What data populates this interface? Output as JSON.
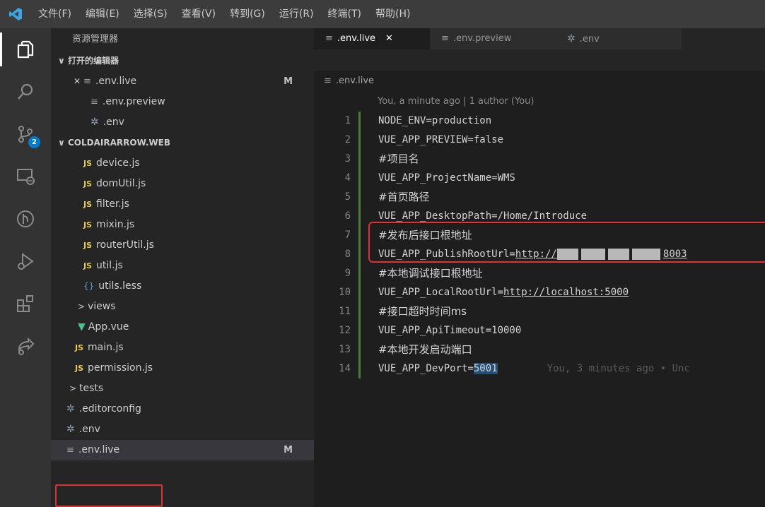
{
  "menu": [
    "文件(F)",
    "编辑(E)",
    "选择(S)",
    "查看(V)",
    "转到(G)",
    "运行(R)",
    "终端(T)",
    "帮助(H)"
  ],
  "activity": {
    "scm_badge": "2"
  },
  "sidebar": {
    "title": "资源管理器",
    "open_editors_label": "打开的编辑器",
    "open_editors": [
      {
        "name": ".env.live",
        "status": "M"
      },
      {
        "name": ".env.preview"
      },
      {
        "name": ".env"
      }
    ],
    "project_label": "COLDAIRARROW.WEB",
    "files": [
      {
        "name": "device.js",
        "kind": "js",
        "js_tag": "JS"
      },
      {
        "name": "domUtil.js",
        "kind": "js",
        "js_tag": "JS"
      },
      {
        "name": "filter.js",
        "kind": "js",
        "js_tag": "JS"
      },
      {
        "name": "mixin.js",
        "kind": "js",
        "js_tag": "JS"
      },
      {
        "name": "routerUtil.js",
        "kind": "js",
        "js_tag": "JS"
      },
      {
        "name": "util.js",
        "kind": "js",
        "js_tag": "JS"
      },
      {
        "name": "utils.less",
        "kind": "less"
      },
      {
        "name": "views",
        "kind": "folder"
      },
      {
        "name": "App.vue",
        "kind": "vue"
      },
      {
        "name": "main.js",
        "kind": "js",
        "js_tag": "JS"
      },
      {
        "name": "permission.js",
        "kind": "js",
        "js_tag": "JS"
      },
      {
        "name": "tests",
        "kind": "folder"
      },
      {
        "name": ".editorconfig",
        "kind": "gear"
      },
      {
        "name": ".env",
        "kind": "gear"
      },
      {
        "name": ".env.live",
        "kind": "lines",
        "status": "M"
      }
    ]
  },
  "tabs": [
    {
      "label": ".env.live",
      "active": true
    },
    {
      "label": ".env.preview",
      "active": false
    },
    {
      "label": ".env",
      "active": false
    }
  ],
  "breadcrumb": ".env.live",
  "editor": {
    "blame_header": "You, a minute ago | 1 author (You)",
    "lines": [
      {
        "n": "1",
        "text": "NODE_ENV=production"
      },
      {
        "n": "2",
        "text": "VUE_APP_PREVIEW=false"
      },
      {
        "n": "3",
        "text": "#项目名"
      },
      {
        "n": "4",
        "text": "VUE_APP_ProjectName=WMS"
      },
      {
        "n": "5",
        "text": "#首页路径"
      },
      {
        "n": "6",
        "text": "VUE_APP_DesktopPath=/Home/Introduce"
      },
      {
        "n": "7",
        "text": "#发布后接口根地址"
      },
      {
        "n": "8",
        "key": "VUE_APP_PublishRootUrl=",
        "url_prefix": "http://",
        "url_suffix": "8003"
      },
      {
        "n": "9",
        "text": "#本地调试接口根地址"
      },
      {
        "n": "10",
        "key": "VUE_APP_LocalRootUrl=",
        "url": "http://localhost:5000"
      },
      {
        "n": "11",
        "text": "#接口超时时间ms"
      },
      {
        "n": "12",
        "text": "VUE_APP_ApiTimeout=10000"
      },
      {
        "n": "13",
        "text": "#本地开发启动端口"
      },
      {
        "n": "14",
        "key": "VUE_APP_DevPort=",
        "value": "5001",
        "ghost": "You, 3 minutes ago • Unc"
      }
    ]
  }
}
